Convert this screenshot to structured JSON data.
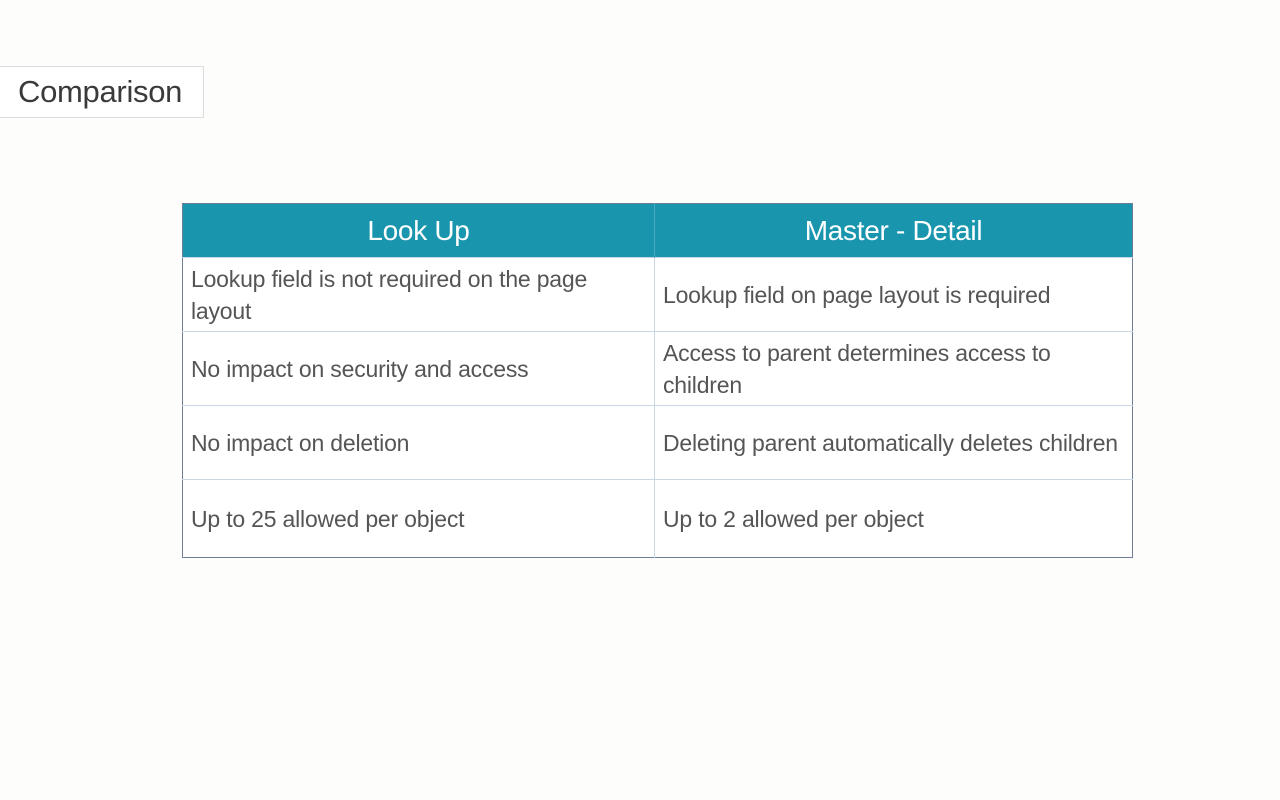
{
  "slide": {
    "title": "Comparison"
  },
  "table": {
    "headers": [
      "Look Up",
      "Master - Detail"
    ],
    "rows": [
      [
        "Lookup field is not required on the page layout",
        "Lookup field on page layout is required"
      ],
      [
        "No impact on security and access",
        "Access to parent determines access to children"
      ],
      [
        "No impact on deletion",
        "Deleting parent automatically deletes children"
      ],
      [
        "Up to 25 allowed per object",
        "Up to 2 allowed per object"
      ]
    ]
  },
  "colors": {
    "header_background": "#1995ad",
    "header_text": "#ffffff",
    "body_text": "#555555",
    "table_border": "#6d7e96"
  }
}
